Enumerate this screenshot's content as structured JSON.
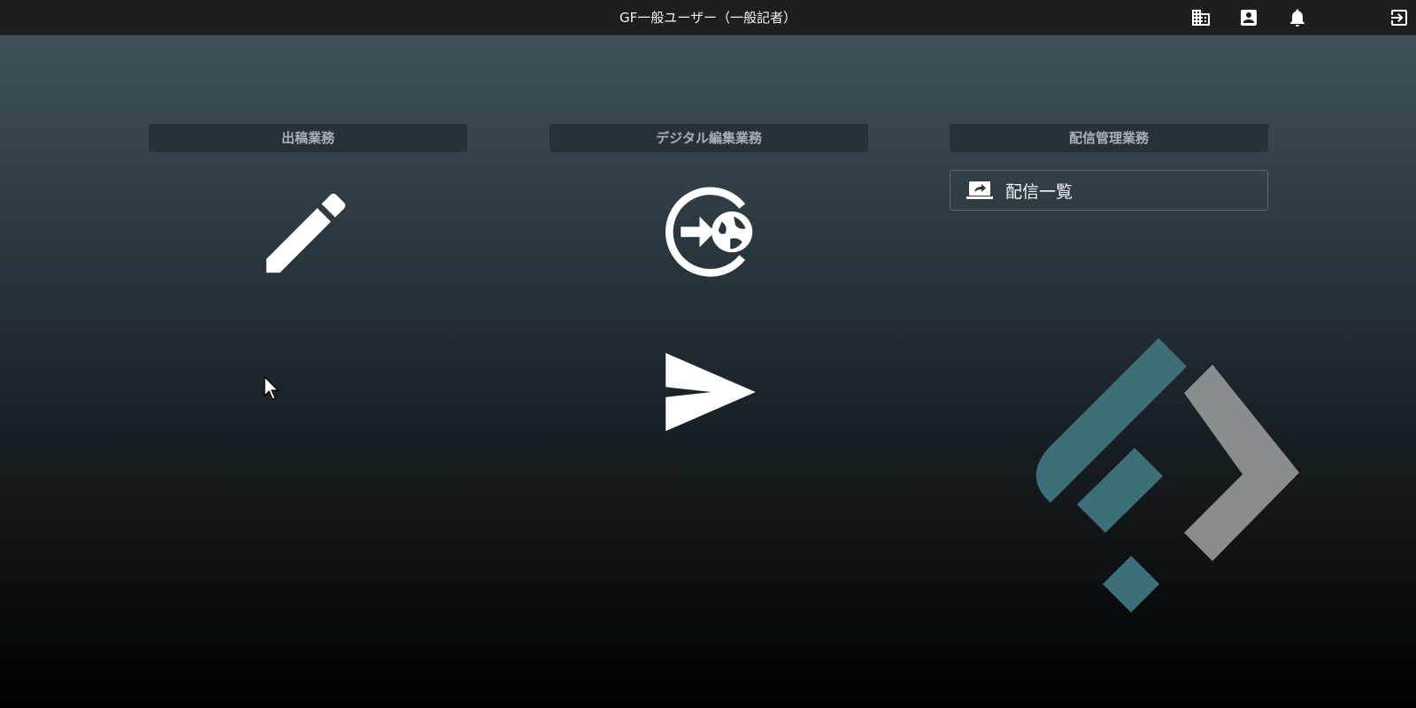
{
  "header": {
    "title": "GF一般ユーザー（一般記者）",
    "icons": [
      "building-icon",
      "account-box-icon",
      "bell-icon",
      "logout-icon"
    ]
  },
  "columns": [
    {
      "title": "出稿業務",
      "tiles": [
        "pencil-icon"
      ]
    },
    {
      "title": "デジタル編集業務",
      "tiles": [
        "web-publish-icon",
        "send-icon"
      ]
    },
    {
      "title": "配信管理業務",
      "buttons": [
        {
          "label": "配信一覧",
          "icon": "laptop-share-icon"
        }
      ]
    }
  ],
  "colors": {
    "topbar": "#1e1e1e",
    "header_bg": "#273238",
    "header_text": "#a9b0b4",
    "logo_teal": "#3d6f78",
    "logo_gray": "#8a8d8f"
  }
}
